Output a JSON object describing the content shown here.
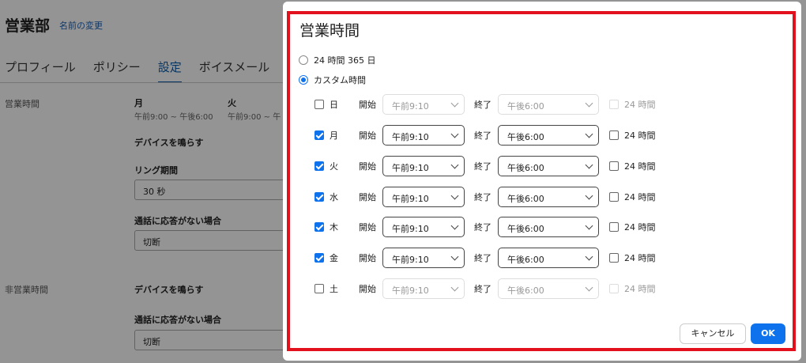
{
  "background": {
    "title": "営業部",
    "rename_link": "名前の変更",
    "tabs": [
      {
        "label": "プロフィール",
        "active": false
      },
      {
        "label": "ポリシー",
        "active": false
      },
      {
        "label": "設定",
        "active": true
      },
      {
        "label": "ボイスメール",
        "active": false
      }
    ],
    "business_hours_label": "営業時間",
    "days_preview": [
      {
        "day": "月",
        "hours": "午前9:00 ~ 午後6:00"
      },
      {
        "day": "火",
        "hours": "午前9:00 ~ 午"
      }
    ],
    "ring_devices_label": "デバイスを鳴らす",
    "ring_period_label": "リング期間",
    "ring_period_value": "30 秒",
    "no_answer_label": "通話に応答がない場合",
    "no_answer_value": "切断",
    "after_hours_label": "非営業時間",
    "after_ring_devices_label": "デバイスを鳴らす",
    "after_no_answer_label": "通話に応答がない場合",
    "after_no_answer_value": "切断"
  },
  "dialog": {
    "title": "営業時間",
    "option_24_365": "24 時間 365 日",
    "option_custom": "カスタム時間",
    "selected_option": "custom",
    "start_label": "開始",
    "end_label": "終了",
    "all_day_label": "24 時間",
    "days": [
      {
        "day": "日",
        "enabled": false,
        "start": "午前9:10",
        "end": "午後6:00"
      },
      {
        "day": "月",
        "enabled": true,
        "start": "午前9:10",
        "end": "午後6:00"
      },
      {
        "day": "火",
        "enabled": true,
        "start": "午前9:10",
        "end": "午後6:00"
      },
      {
        "day": "水",
        "enabled": true,
        "start": "午前9:10",
        "end": "午後6:00"
      },
      {
        "day": "木",
        "enabled": true,
        "start": "午前9:10",
        "end": "午後6:00"
      },
      {
        "day": "金",
        "enabled": true,
        "start": "午前9:10",
        "end": "午後6:00"
      },
      {
        "day": "土",
        "enabled": false,
        "start": "午前9:10",
        "end": "午後6:00"
      }
    ],
    "cancel_label": "キャンセル",
    "ok_label": "OK"
  },
  "colors": {
    "accent": "#0e72ed",
    "highlight_frame": "#e3111e"
  }
}
